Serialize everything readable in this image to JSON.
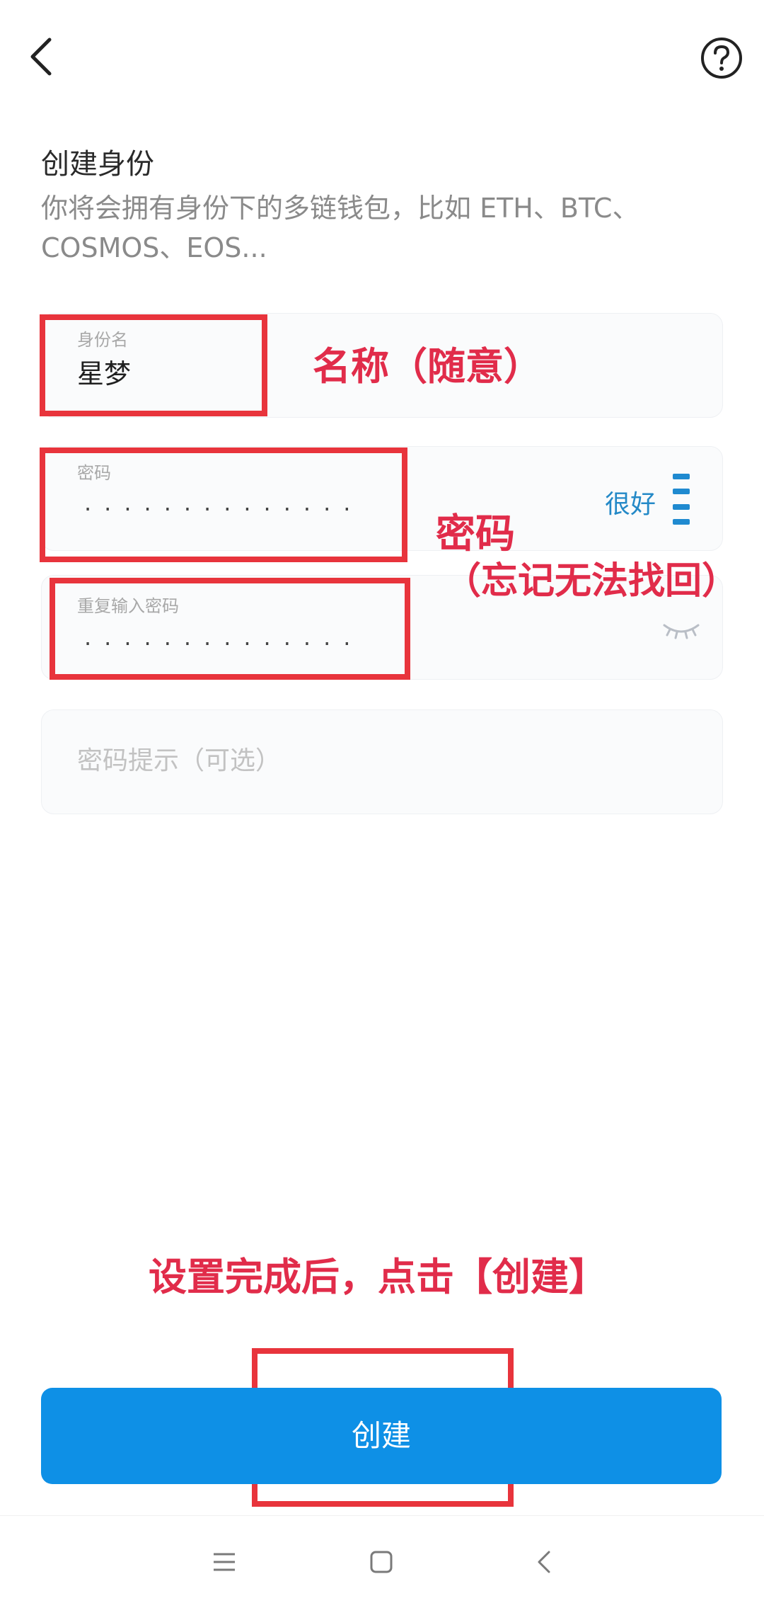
{
  "header": {
    "back_icon": "chevron-left-icon",
    "help_icon": "question-circle-icon"
  },
  "page": {
    "title": "创建身份",
    "subtitle": "你将会拥有身份下的多链钱包，比如 ETH、BTC、COSMOS、EOS..."
  },
  "form": {
    "identity_name": {
      "label": "身份名",
      "value": "星梦"
    },
    "password": {
      "label": "密码",
      "value": "··············",
      "strength_label": "很好",
      "strength_icon": "strength-bars-icon"
    },
    "repeat_password": {
      "label": "重复输入密码",
      "value": "··············",
      "visibility_icon": "eye-closed-icon"
    },
    "password_hint": {
      "placeholder": "密码提示（可选）"
    }
  },
  "annotations": {
    "name_note": "名称（随意）",
    "password_note_line1": "密码",
    "password_note_line2": "（忘记无法找回）",
    "create_note": "设置完成后，点击【创建】"
  },
  "actions": {
    "create_label": "创建"
  },
  "system_nav": {
    "menu_icon": "menu-icon",
    "home_icon": "home-square-icon",
    "back_icon": "back-triangle-icon"
  },
  "colors": {
    "primary": "#0e90e6",
    "annotation_red": "#e12c4a",
    "strength_blue": "#2489c7"
  }
}
